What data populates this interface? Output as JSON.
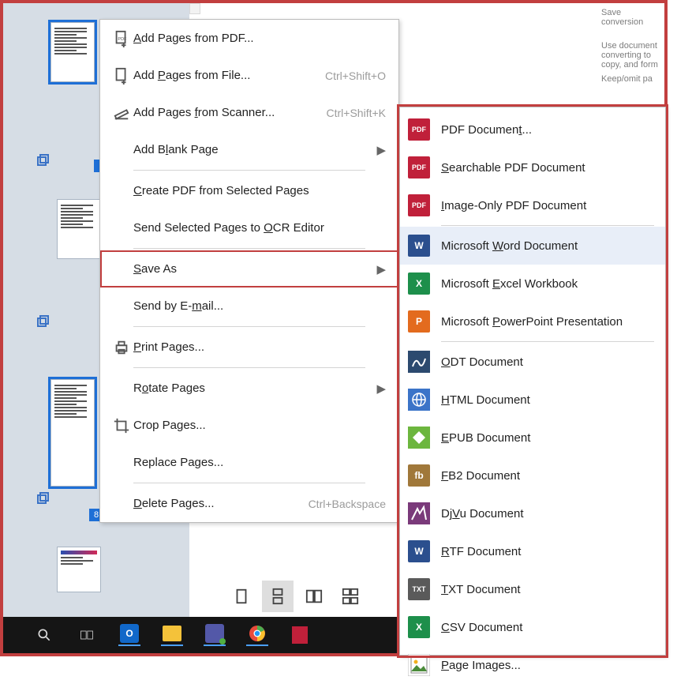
{
  "info": {
    "l1": "Save conversion",
    "l2": "Use document",
    "l3": "converting to",
    "l4": "copy, and form",
    "l5": "Keep/omit pa"
  },
  "pagenum": "8",
  "ctx": {
    "add_pdf": "Add Pages from PDF...",
    "add_file": "Add Pages from File...",
    "add_file_hint": "Ctrl+Shift+O",
    "add_scan": "Add Pages from Scanner...",
    "add_scan_hint": "Ctrl+Shift+K",
    "add_blank": "Add Blank Page",
    "create_pdf": "Create PDF from Selected Pages",
    "send_ocr": "Send Selected Pages to OCR Editor",
    "save_as": "Save As",
    "send_email": "Send by E-mail...",
    "print": "Print Pages...",
    "rotate": "Rotate Pages",
    "crop": "Crop Pages...",
    "replace": "Replace Pages...",
    "delete": "Delete Pages...",
    "delete_hint": "Ctrl+Backspace"
  },
  "saveas": [
    {
      "icon": "PDF",
      "bg": "#c0203a",
      "label": "PDF Document...",
      "u": 11
    },
    {
      "icon": "PDF",
      "bg": "#c0203a",
      "label": "Searchable PDF Document",
      "u": 0
    },
    {
      "icon": "PDF",
      "bg": "#c0203a",
      "label": "Image-Only PDF Document",
      "u": 0
    },
    {
      "icon": "W",
      "bg": "#2b4f8e",
      "label": "Microsoft Word Document",
      "u": 10,
      "hov": true
    },
    {
      "icon": "X",
      "bg": "#1d8f4b",
      "label": "Microsoft Excel Workbook",
      "u": 10
    },
    {
      "icon": "P",
      "bg": "#e36b1e",
      "label": "Microsoft PowerPoint Presentation",
      "u": 10
    },
    {
      "icon": "ODT",
      "bg": "#2c4a6f",
      "label": "ODT Document",
      "u": 0,
      "svg": "odt"
    },
    {
      "icon": "@",
      "bg": "#3b74c8",
      "label": "HTML Document",
      "u": 0,
      "svg": "globe"
    },
    {
      "icon": "E",
      "bg": "#6cb63e",
      "label": "EPUB Document",
      "u": 0,
      "svg": "epub"
    },
    {
      "icon": "fb",
      "bg": "#a0783a",
      "label": "FB2 Document",
      "u": 0
    },
    {
      "icon": "DjVu",
      "bg": "#7a3a7a",
      "label": "DjVu Document",
      "u": 2,
      "svg": "djvu"
    },
    {
      "icon": "W",
      "bg": "#2b4f8e",
      "label": "RTF Document",
      "u": 0
    },
    {
      "icon": "TXT",
      "bg": "#5a5a5a",
      "label": "TXT Document",
      "u": 0
    },
    {
      "icon": "X",
      "bg": "#1d8f4b",
      "label": "CSV Document",
      "u": 0
    },
    {
      "icon": "IMG",
      "bg": "#f0f0f0",
      "label": "Page Images...",
      "u": 0,
      "svg": "img"
    }
  ]
}
